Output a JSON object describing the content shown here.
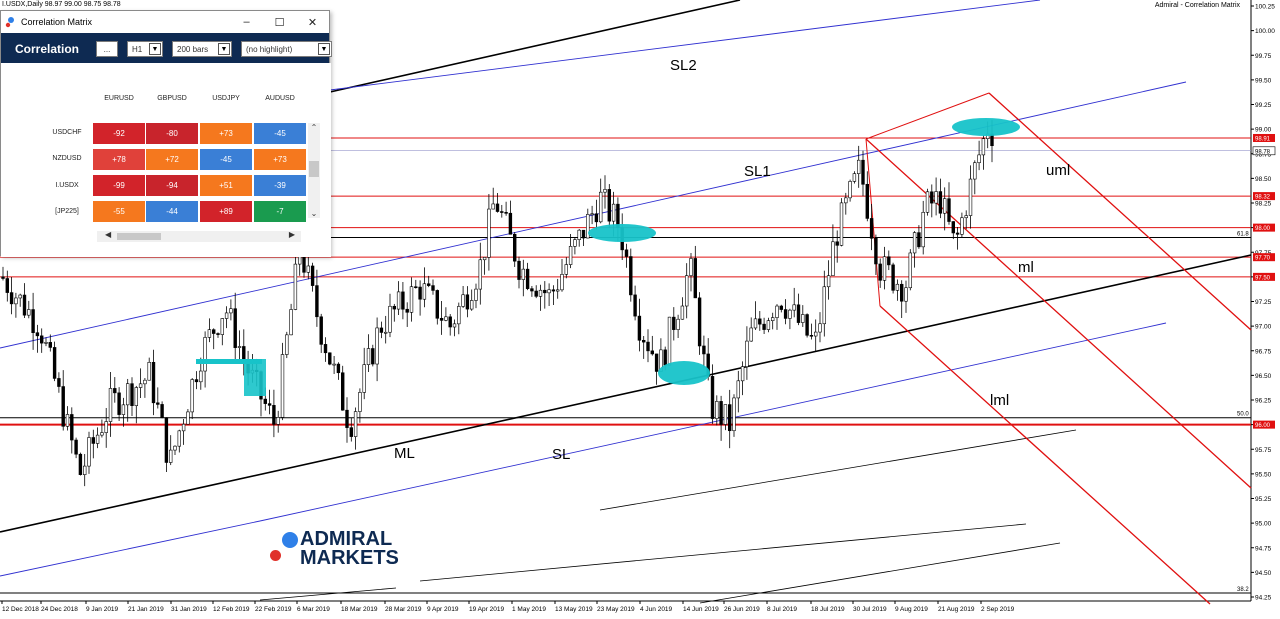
{
  "chart": {
    "header_left": "I.USDX,Daily  98.97 99.00 98.75 98.78",
    "header_right": "Admiral - Correlation Matrix",
    "price_ticks": [
      "100.25",
      "100.00",
      "99.75",
      "99.50",
      "99.25",
      "99.00",
      "98.75",
      "98.50",
      "98.25",
      "98.00",
      "97.75",
      "97.50",
      "97.25",
      "97.00",
      "96.75",
      "96.50",
      "96.25",
      "96.00",
      "95.75",
      "95.50",
      "95.25",
      "95.00",
      "94.75",
      "94.50",
      "94.25"
    ],
    "date_ticks": [
      "12 Dec 2018",
      "24 Dec 2018",
      "9 Jan 2019",
      "21 Jan 2019",
      "31 Jan 2019",
      "12 Feb 2019",
      "22 Feb 2019",
      "6 Mar 2019",
      "18 Mar 2019",
      "28 Mar 2019",
      "9 Apr 2019",
      "19 Apr 2019",
      "1 May 2019",
      "13 May 2019",
      "23 May 2019",
      "4 Jun 2019",
      "14 Jun 2019",
      "26 Jun 2019",
      "8 Jul 2019",
      "18 Jul 2019",
      "30 Jul 2019",
      "9 Aug 2019",
      "21 Aug 2019",
      "2 Sep 2019"
    ],
    "price_markers": [
      {
        "label": "98.91",
        "style": "red"
      },
      {
        "label": "98.78",
        "style": "white"
      },
      {
        "label": "98.32",
        "style": "red"
      },
      {
        "label": "98.00",
        "style": "red"
      },
      {
        "label": "97.70",
        "style": "red"
      },
      {
        "label": "97.50",
        "style": "red"
      },
      {
        "label": "96.00",
        "style": "red"
      }
    ],
    "fib_labels": [
      "61.8",
      "50.0",
      "38.2"
    ],
    "annotations": [
      "SL2",
      "SL1",
      "uml",
      "ml",
      "lml",
      "ML",
      "SL"
    ],
    "logo_text": [
      "ADMIRAL",
      "MARKETS"
    ],
    "colors": {
      "red": "#e01010",
      "blue": "#3030d0",
      "teal": "#17c3c9",
      "marker_red": "#e01010"
    }
  },
  "dialog": {
    "title": "Correlation Matrix",
    "toolbar_title": "Correlation",
    "more_button": "...",
    "timeframe": "H1",
    "bars": "200 bars",
    "highlight": "(no highlight)",
    "columns": [
      "EURUSD",
      "GBPUSD",
      "USDJPY",
      "AUDUSD"
    ],
    "rows": [
      {
        "label": "USDCHF",
        "values": [
          "-92",
          "-80",
          "+73",
          "-45"
        ]
      },
      {
        "label": "NZDUSD",
        "values": [
          "+78",
          "+72",
          "-45",
          "+73"
        ]
      },
      {
        "label": "I.USDX",
        "values": [
          "-99",
          "-94",
          "+51",
          "-39"
        ]
      },
      {
        "label": "[JP225]",
        "values": [
          "-55",
          "-44",
          "+89",
          "-7"
        ]
      }
    ],
    "cell_colors": {
      "strong_neg": "#d2232a",
      "mid_neg": "#c02a34",
      "pos_high": "#e8423c",
      "pos_orange": "#f5781e",
      "neg_blue": "#3a7fd6",
      "pos_green": "#1a9b4f"
    }
  }
}
